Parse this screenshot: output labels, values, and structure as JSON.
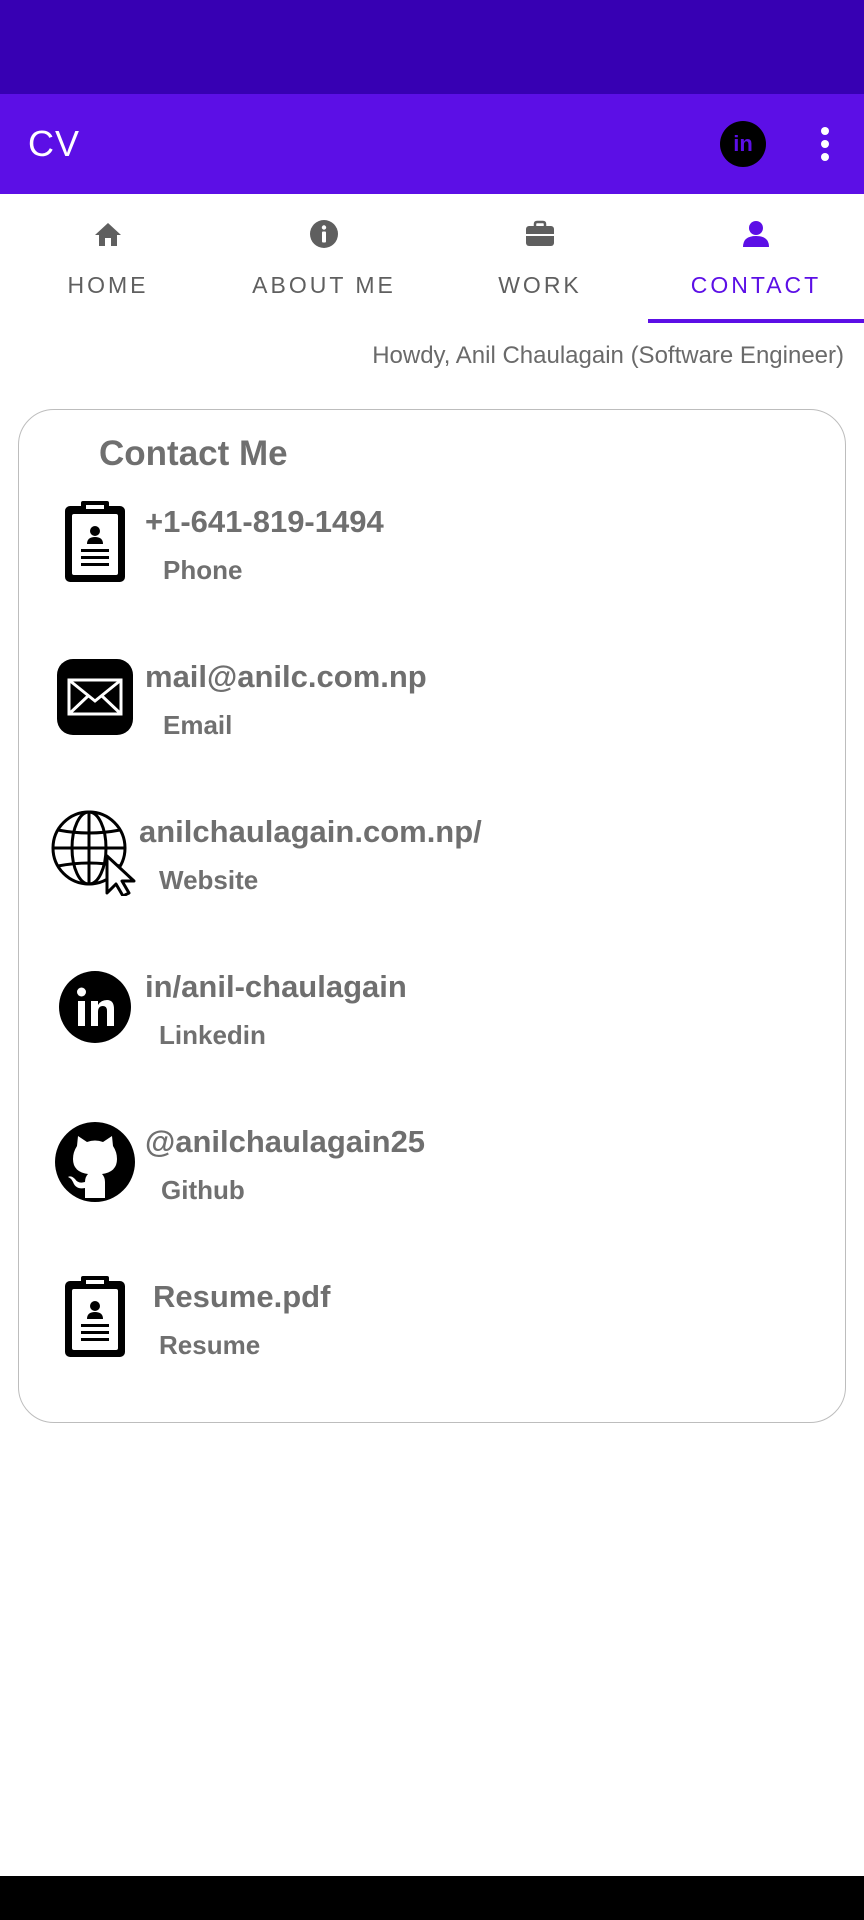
{
  "app_bar": {
    "title": "CV",
    "linkedin_glyph": "in",
    "action_icons": [
      "linkedin-icon",
      "more-vert-icon"
    ]
  },
  "tabs": [
    {
      "label": "HOME",
      "icon": "home-icon",
      "active": false
    },
    {
      "label": "ABOUT ME",
      "icon": "info-icon",
      "active": false
    },
    {
      "label": "WORK",
      "icon": "briefcase-icon",
      "active": false
    },
    {
      "label": "CONTACT",
      "icon": "person-icon",
      "active": true
    }
  ],
  "greeting": "Howdy, Anil Chaulagain (Software Engineer)",
  "contact": {
    "title": "Contact Me",
    "items": [
      {
        "value": "+1-641-819-1494",
        "label": "Phone",
        "icon": "clipboard-icon"
      },
      {
        "value": "mail@anilc.com.np",
        "label": "Email",
        "icon": "envelope-icon"
      },
      {
        "value": "anilchaulagain.com.np/",
        "label": "Website",
        "icon": "globe-cursor-icon"
      },
      {
        "value": "in/anil-chaulagain",
        "label": "Linkedin",
        "icon": "linkedin-icon"
      },
      {
        "value": "@anilchaulagain25",
        "label": "Github",
        "icon": "github-icon"
      },
      {
        "value": "Resume.pdf",
        "label": "Resume",
        "icon": "clipboard-icon"
      }
    ]
  },
  "colors": {
    "status_bar": "#3700b3",
    "primary": "#5c0fe6",
    "text_gray": "#6f6f6f",
    "nav_bar": "#000000"
  }
}
